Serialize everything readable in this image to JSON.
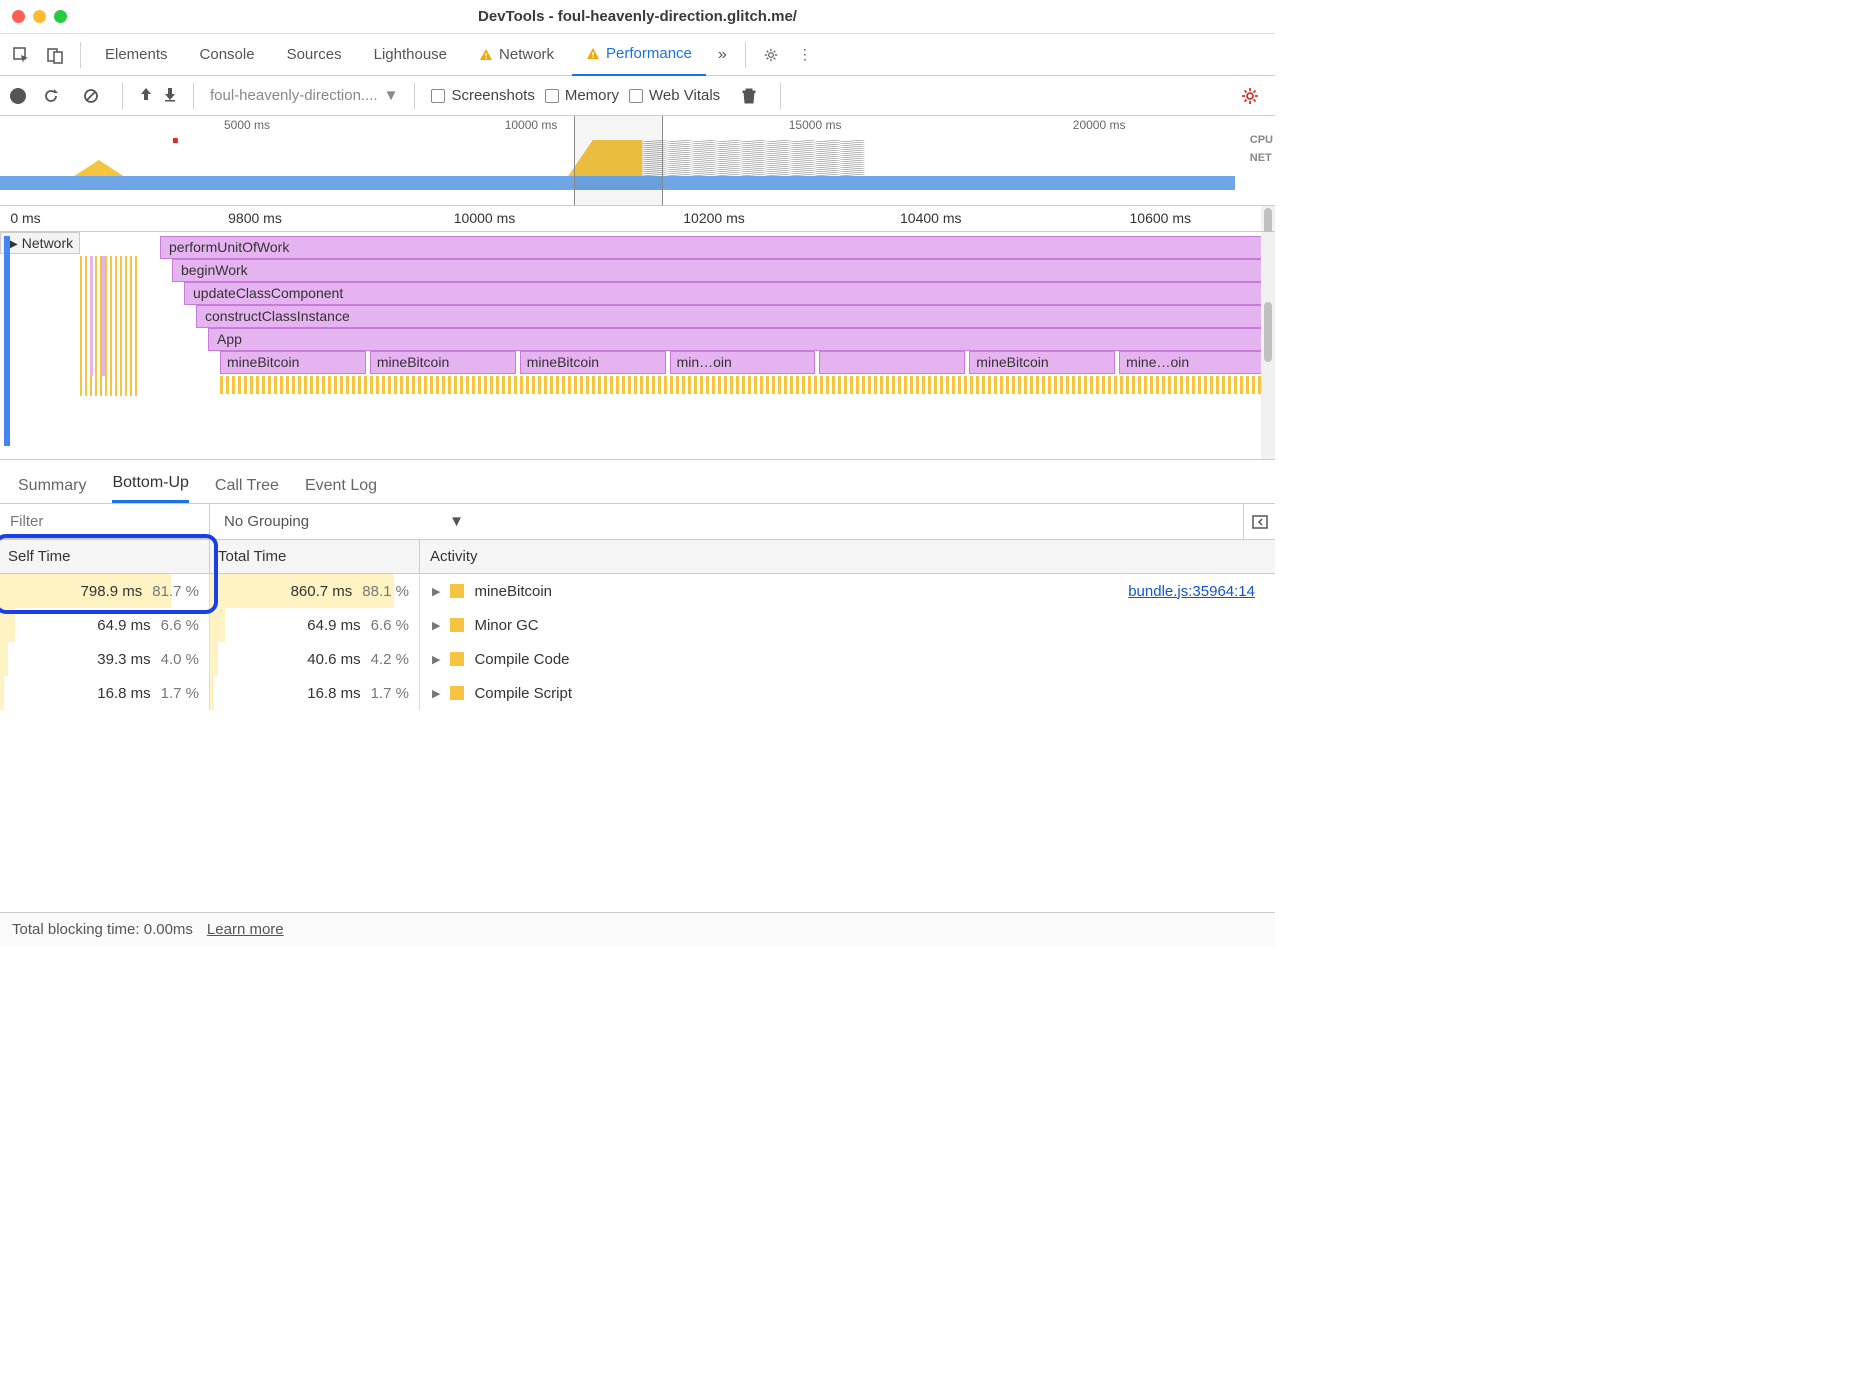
{
  "window": {
    "title": "DevTools - foul-heavenly-direction.glitch.me/"
  },
  "tabs": {
    "items": [
      "Elements",
      "Console",
      "Sources",
      "Lighthouse",
      "Network",
      "Performance"
    ],
    "active": 5,
    "warn_on": [
      4,
      5
    ]
  },
  "toolbar": {
    "recording_label": "foul-heavenly-direction....",
    "checkboxes": [
      "Screenshots",
      "Memory",
      "Web Vitals"
    ]
  },
  "overview": {
    "ticks": [
      {
        "label": "5000 ms",
        "pct": 20
      },
      {
        "label": "10000 ms",
        "pct": 43
      },
      {
        "label": "15000 ms",
        "pct": 66
      },
      {
        "label": "20000 ms",
        "pct": 89
      }
    ],
    "labels": {
      "cpu": "CPU",
      "net": "NET"
    },
    "highlight": {
      "left_pct": 45,
      "width_pct": 7
    }
  },
  "ruler": {
    "ticks": [
      {
        "label": "0 ms",
        "pct": 2
      },
      {
        "label": "9800 ms",
        "pct": 20
      },
      {
        "label": "10000 ms",
        "pct": 38
      },
      {
        "label": "10200 ms",
        "pct": 56
      },
      {
        "label": "10400 ms",
        "pct": 73
      },
      {
        "label": "10600 ms",
        "pct": 91
      }
    ]
  },
  "flame": {
    "network_label": "Network",
    "stack": [
      "performUnitOfWork",
      "beginWork",
      "updateClassComponent",
      "constructClassInstance",
      "App"
    ],
    "mine": [
      "mineBitcoin",
      "mineBitcoin",
      "mineBitcoin",
      "min…oin",
      "",
      "mineBitcoin",
      "mine…oin"
    ]
  },
  "bottom_tabs": {
    "items": [
      "Summary",
      "Bottom-Up",
      "Call Tree",
      "Event Log"
    ],
    "active": 1
  },
  "filter": {
    "placeholder": "Filter",
    "grouping": "No Grouping"
  },
  "table": {
    "headers": {
      "self": "Self Time",
      "total": "Total Time",
      "activity": "Activity"
    },
    "rows": [
      {
        "self_ms": "798.9 ms",
        "self_pct": "81.7 %",
        "self_bar": 82,
        "total_ms": "860.7 ms",
        "total_pct": "88.1 %",
        "total_bar": 88,
        "activity": "mineBitcoin",
        "link": "bundle.js:35964:14"
      },
      {
        "self_ms": "64.9 ms",
        "self_pct": "6.6 %",
        "self_bar": 7,
        "total_ms": "64.9 ms",
        "total_pct": "6.6 %",
        "total_bar": 7,
        "activity": "Minor GC",
        "link": ""
      },
      {
        "self_ms": "39.3 ms",
        "self_pct": "4.0 %",
        "self_bar": 4,
        "total_ms": "40.6 ms",
        "total_pct": "4.2 %",
        "total_bar": 4,
        "activity": "Compile Code",
        "link": ""
      },
      {
        "self_ms": "16.8 ms",
        "self_pct": "1.7 %",
        "self_bar": 2,
        "total_ms": "16.8 ms",
        "total_pct": "1.7 %",
        "total_bar": 2,
        "activity": "Compile Script",
        "link": ""
      }
    ]
  },
  "status": {
    "blocking": "Total blocking time: 0.00ms",
    "learn": "Learn more"
  }
}
